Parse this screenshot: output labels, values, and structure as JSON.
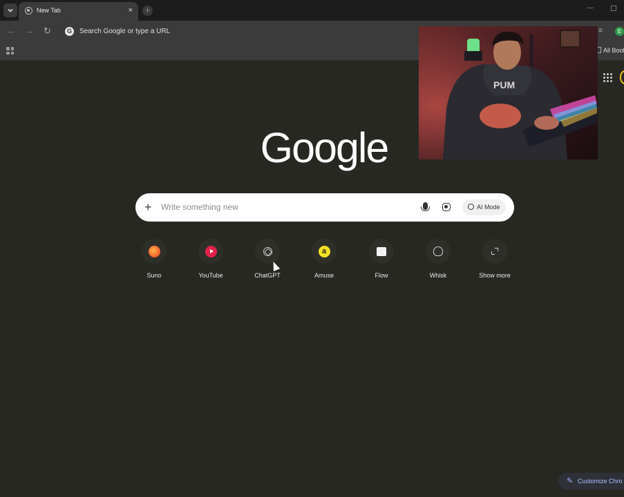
{
  "browser": {
    "tab": {
      "title": "New Tab",
      "close_glyph": "×"
    },
    "new_tab_glyph": "+",
    "window_min_glyph": "—",
    "nav": {
      "back_glyph": "←",
      "forward_glyph": "→",
      "reload_glyph": "↻"
    },
    "omnibox": {
      "glyph": "G",
      "text": "Search Google or type a URL"
    },
    "profile_initial": "E",
    "bookmarks": {
      "all_bookmarks_label": "All Bool"
    }
  },
  "page": {
    "logo_text": "Google",
    "search": {
      "plus_glyph": "+",
      "placeholder": "Write something new",
      "ai_mode_label": "AI Mode"
    },
    "shortcuts": [
      {
        "label": "Suno",
        "icon": "suno-icon"
      },
      {
        "label": "YouTube",
        "icon": "youtube-icon"
      },
      {
        "label": "ChatGPT",
        "icon": "chatgpt-icon"
      },
      {
        "label": "Amuse",
        "icon": "amuse-icon",
        "glyph": "a"
      },
      {
        "label": "Flow",
        "icon": "flow-icon"
      },
      {
        "label": "Whisk",
        "icon": "whisk-icon"
      },
      {
        "label": "Show more",
        "icon": "expand-icon"
      }
    ],
    "customize": {
      "label": "Customize Chro",
      "glyph": "✎"
    }
  },
  "colors": {
    "background": "#282823",
    "toolbar": "#3b3b3b",
    "search_box": "#ffffff",
    "customize_text": "#a8c0ff"
  }
}
